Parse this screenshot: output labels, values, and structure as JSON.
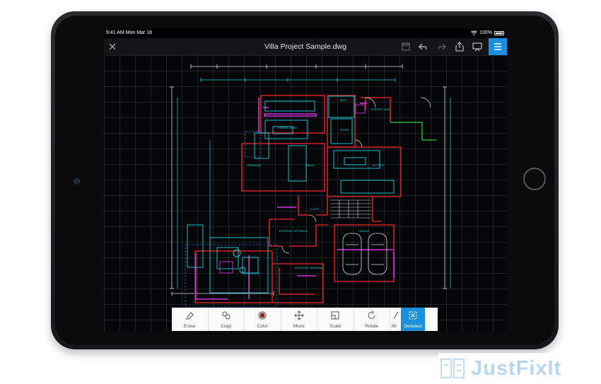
{
  "status_bar": {
    "time": "9:41 AM  Mon Mar 18",
    "battery": "100%"
  },
  "titlebar": {
    "file_name": "Villa Project Sample.dwg"
  },
  "drawing": {
    "rooms": [
      {
        "name": "FORMAL LIVING",
        "label": "FORMAL LIVING"
      },
      {
        "name": "BATH",
        "label": "BATH"
      },
      {
        "name": "STORE",
        "label": "STORE"
      },
      {
        "name": "SERVICE YARD",
        "label": "SERVICE YARD"
      },
      {
        "name": "VERANDAH",
        "label": "VERANDAH"
      },
      {
        "name": "DINING",
        "label": "DINING"
      },
      {
        "name": "KITCHEN",
        "label": "KITCHEN"
      },
      {
        "name": "FOYER",
        "label": "FOYER"
      },
      {
        "name": "ENTRANCE VESTIBULE",
        "label": "ENTRANCE VESTIBULE"
      },
      {
        "name": "GARAGE",
        "label": "GARAGE"
      },
      {
        "name": "LIVING ROOM",
        "label": "LIVING ROOM"
      },
      {
        "name": "ENTRANCE VERANDAH",
        "label": "ENTRANCE VERANDAH"
      }
    ]
  },
  "toolbar": {
    "erase": "Erase",
    "copy": "Copy",
    "color": "Color",
    "move": "Move",
    "scale": "Scale",
    "rotate": "Rotate",
    "mirror": "Mi",
    "deselect": "Deselect"
  },
  "watermark": {
    "text": "JustFixIt"
  },
  "colors": {
    "accent": "#1b8fdb",
    "wall": "#d0202a",
    "cyan": "#1fd0e0",
    "magenta": "#d030e0",
    "white_lines": "#d8d8d8"
  }
}
